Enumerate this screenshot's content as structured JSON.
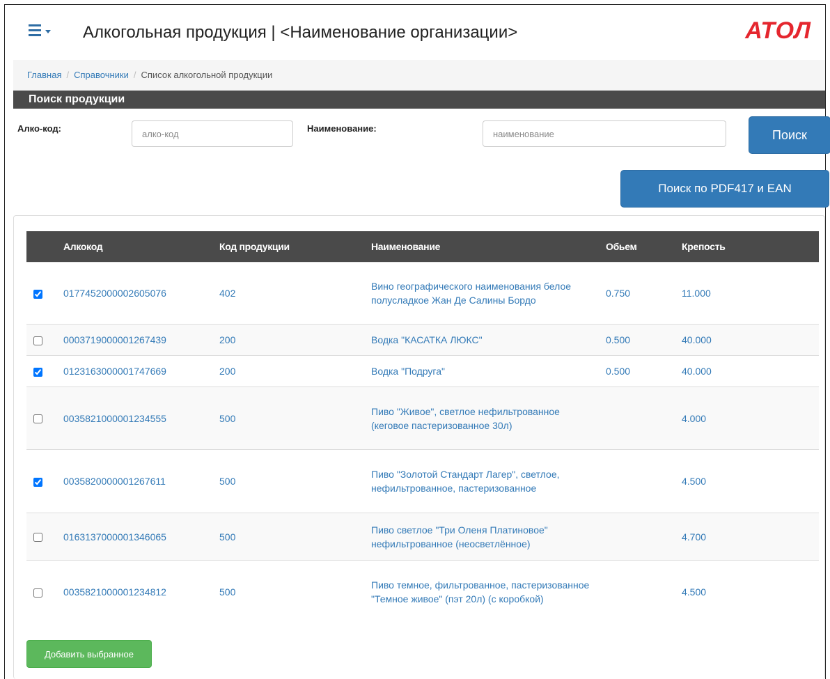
{
  "header": {
    "title": "Алкогольная продукция | <Наименование организации>",
    "logo": "АТОЛ"
  },
  "breadcrumb": {
    "home": "Главная",
    "section": "Справочники",
    "current": "Список алкогольной продукции",
    "separator": "/"
  },
  "search": {
    "header": "Поиск продукции",
    "alco_label": "Алко-код:",
    "alco_placeholder": "алко-код",
    "name_label": "Наименование:",
    "name_placeholder": "наименование",
    "search_button": "Поиск",
    "barcode_button": "Поиск по PDF417 и EAN"
  },
  "table": {
    "columns": [
      "Алкокод",
      "Код продукции",
      "Наименование",
      "Обьем",
      "Крепость"
    ],
    "rows": [
      {
        "checked": true,
        "alcocode": "0177452000002605076",
        "product_code": "402",
        "name": "Вино географического наименования белое полусладкое Жан Де Салины Бордо",
        "volume": "0.750",
        "strength": "11.000"
      },
      {
        "checked": false,
        "alcocode": "0003719000001267439",
        "product_code": "200",
        "name": "Водка \"КАСАТКА ЛЮКС\"",
        "volume": "0.500",
        "strength": "40.000"
      },
      {
        "checked": true,
        "alcocode": "0123163000001747669",
        "product_code": "200",
        "name": "Водка \"Подруга\"",
        "volume": "0.500",
        "strength": "40.000"
      },
      {
        "checked": false,
        "alcocode": "0035821000001234555",
        "product_code": "500",
        "name": "Пиво \"Живое\", светлое нефильтрованное (кеговое пастеризованное 30л)",
        "volume": "",
        "strength": "4.000"
      },
      {
        "checked": true,
        "alcocode": "0035820000001267611",
        "product_code": "500",
        "name": "Пиво \"Золотой Стандарт Лагер\", светлое, нефильтрованное, пастеризованное",
        "volume": "",
        "strength": "4.500"
      },
      {
        "checked": false,
        "alcocode": "0163137000001346065",
        "product_code": "500",
        "name": "Пиво светлое \"Три Оленя Платиновое\" нефильтрованное (неосветлённое)",
        "volume": "",
        "strength": "4.700"
      },
      {
        "checked": false,
        "alcocode": "0035821000001234812",
        "product_code": "500",
        "name": "Пиво темное, фильтрованное, пастеризованное \"Темное живое\" (пэт 20л) (с коробкой)",
        "volume": "",
        "strength": "4.500"
      }
    ]
  },
  "actions": {
    "add_selected": "Добавить выбранное"
  },
  "colors": {
    "primary": "#337ab7",
    "success": "#5cb85c",
    "header_bg": "#4a4a4a",
    "logo": "#e5262e"
  }
}
